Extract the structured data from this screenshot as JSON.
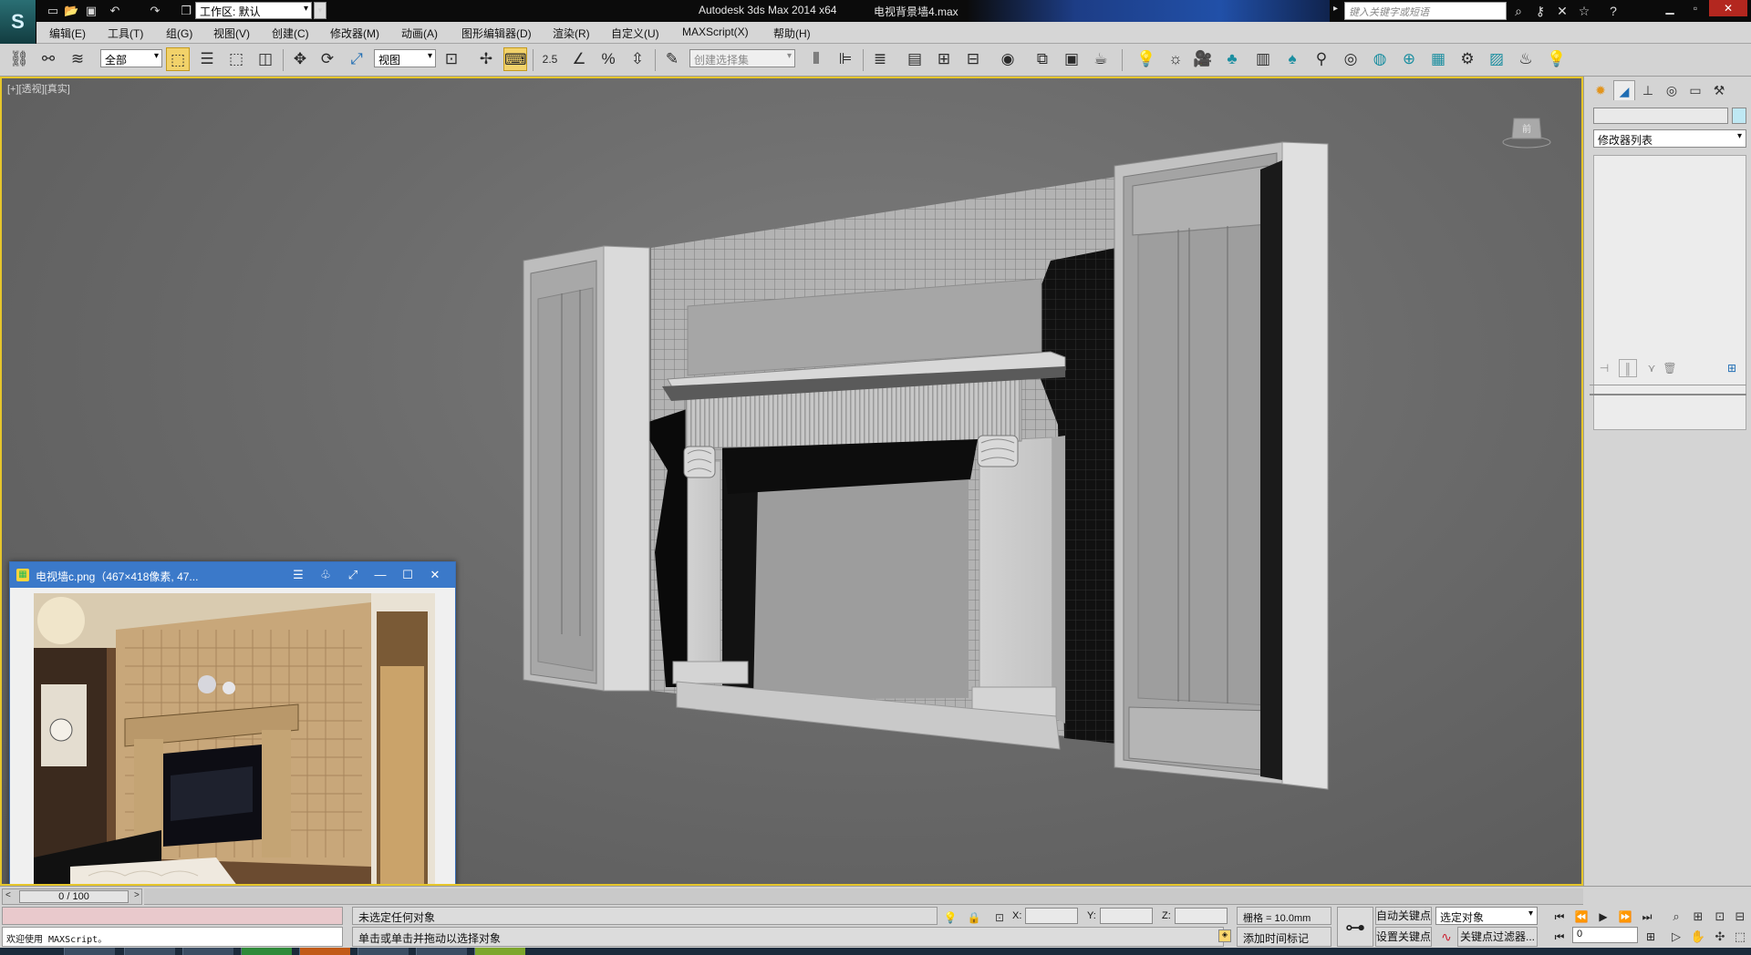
{
  "titlebar": {
    "workspace_label": "工作区: 默认",
    "app_title": "Autodesk 3ds Max  2014 x64",
    "file_name": "电视背景墙4.max",
    "search_placeholder": "键入关键字或短语"
  },
  "menubar": {
    "items": [
      "编辑(E)",
      "工具(T)",
      "组(G)",
      "视图(V)",
      "创建(C)",
      "修改器(M)",
      "动画(A)",
      "图形编辑器(D)",
      "渲染(R)",
      "自定义(U)",
      "MAXScript(X)",
      "帮助(H)"
    ]
  },
  "toolbar": {
    "selection_filter": "全部",
    "reference_coord": "视图",
    "snap_value": "2.5",
    "named_selection_placeholder": "创建选择集"
  },
  "viewport": {
    "label": "[+][透视][真实]",
    "viewcube_face": "前"
  },
  "image_viewer": {
    "title": "电视墙c.png（467×418像素, 47..."
  },
  "command_panel": {
    "modifier_list_label": "修改器列表"
  },
  "timeline": {
    "slider_value": "0 / 100"
  },
  "statusbar": {
    "maxscript_welcome": "欢迎使用 MAXScript。",
    "selection_status": "未选定任何对象",
    "prompt": "单击或单击并拖动以选择对象",
    "x_label": "X:",
    "y_label": "Y:",
    "z_label": "Z:",
    "grid_label": "栅格 = 10.0mm",
    "add_time_tag": "添加时间标记",
    "auto_key": "自动关键点",
    "set_key": "设置关键点",
    "key_mode": "选定对象",
    "key_filters": "关键点过滤器...",
    "current_frame": "0"
  }
}
